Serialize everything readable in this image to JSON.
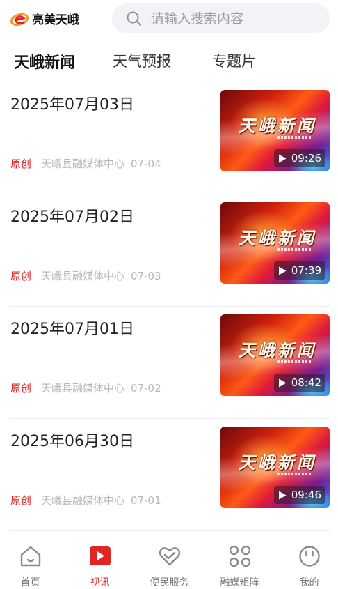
{
  "header": {
    "logo_text": "亮美天峨",
    "search_placeholder": "请输入搜索内容"
  },
  "tabs": [
    {
      "label": "天峨新闻",
      "active": true
    },
    {
      "label": "天气预报",
      "active": false
    },
    {
      "label": "专题片",
      "active": false
    }
  ],
  "thumbnail_text": "天峨新闻",
  "items": [
    {
      "title": "2025年07月03日",
      "badge": "原创",
      "source": "天峨县融媒体中心",
      "date": "07-04",
      "duration": "09:26"
    },
    {
      "title": "2025年07月02日",
      "badge": "原创",
      "source": "天峨县融媒体中心",
      "date": "07-03",
      "duration": "07:39"
    },
    {
      "title": "2025年07月01日",
      "badge": "原创",
      "source": "天峨县融媒体中心",
      "date": "07-02",
      "duration": "08:42"
    },
    {
      "title": "2025年06月30日",
      "badge": "原创",
      "source": "天峨县融媒体中心",
      "date": "07-01",
      "duration": "09:46"
    }
  ],
  "bottom_nav": [
    {
      "label": "首页",
      "icon": "home-icon",
      "active": false
    },
    {
      "label": "视讯",
      "icon": "video-icon",
      "active": true
    },
    {
      "label": "便民服务",
      "icon": "heart-hands-icon",
      "active": false
    },
    {
      "label": "融媒矩阵",
      "icon": "grid-icon",
      "active": false
    },
    {
      "label": "我的",
      "icon": "smiley-icon",
      "active": false
    }
  ],
  "colors": {
    "accent": "#e02626",
    "search_bg": "#f2f3f7",
    "meta_text": "#b6b6bc",
    "logo_orange": "#f39a1a"
  }
}
